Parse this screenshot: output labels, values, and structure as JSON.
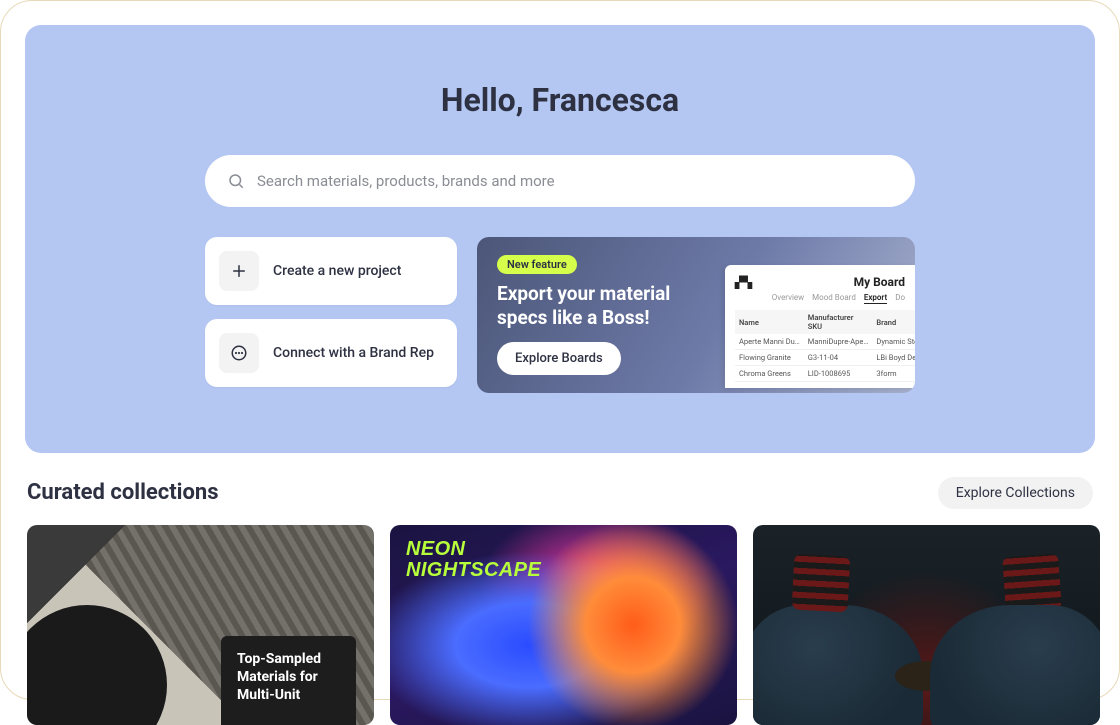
{
  "hero": {
    "greeting": "Hello, Francesca",
    "search_placeholder": "Search materials, products, brands and more"
  },
  "actions": {
    "create_project": "Create a new project",
    "connect_rep": "Connect with a Brand Rep"
  },
  "promo": {
    "badge": "New feature",
    "title": "Export your material specs like a Boss!",
    "button": "Explore Boards",
    "preview": {
      "logo": "⬚",
      "board_title": "My Board",
      "tabs": [
        "Overview",
        "Mood Board",
        "Export",
        "Do"
      ],
      "active_tab": 2,
      "headers": [
        "Name",
        "Manufacturer SKU",
        "Brand"
      ],
      "rows": [
        [
          "Aperte Manni Du…",
          "ManniDupre-Ape…",
          "Dynamic Stone"
        ],
        [
          "Flowing Granite",
          "G3-11-04",
          "LBi Boyd Design …"
        ],
        [
          "Chroma Greens",
          "LID-1008695",
          "3form"
        ]
      ]
    }
  },
  "collections": {
    "section_title": "Curated collections",
    "explore_button": "Explore Collections",
    "items": [
      {
        "title": "Top-Sampled Materials for Multi-Unit"
      },
      {
        "title": "NEON\nNIGHTSCAPE"
      },
      {
        "title": ""
      }
    ]
  }
}
